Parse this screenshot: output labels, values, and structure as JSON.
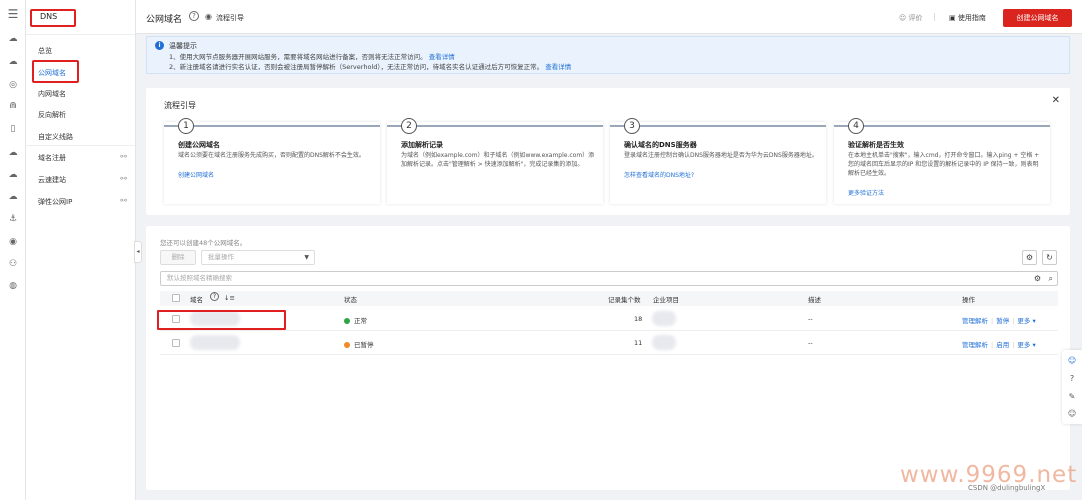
{
  "service": "DNS",
  "sidebar": {
    "items": [
      {
        "label": "总览",
        "active": false,
        "external": false
      },
      {
        "label": "公网域名",
        "active": true,
        "external": false
      },
      {
        "label": "内网域名",
        "active": false,
        "external": false
      },
      {
        "label": "反向解析",
        "active": false,
        "external": false
      },
      {
        "label": "自定义线路",
        "active": false,
        "external": false
      },
      {
        "label": "域名注册",
        "active": false,
        "external": true
      },
      {
        "label": "云速建站",
        "active": false,
        "external": true
      },
      {
        "label": "弹性公网IP",
        "active": false,
        "external": true
      }
    ]
  },
  "header": {
    "title": "公网域名",
    "flow_guide": "流程引导",
    "rate": "评价",
    "guide": "使用指南",
    "create_button": "创建公网域名"
  },
  "notice": {
    "title": "温馨提示",
    "line1": "1、使用大网节点服务器开展网站服务，需要将域名网站进行备案，否则将无法正常访问。",
    "line1_link": "查看详情",
    "line2": "2、新注册域名请进行实名认证，否则会被注册局暂停解析（Serverhold），无法正常访问，待域名实名认证通过后方可恢复正常。",
    "line2_link": "查看详情"
  },
  "flow": {
    "title": "流程引导",
    "steps": [
      {
        "num": "1",
        "title": "创建公网域名",
        "desc": "域名公须要在域名注册服务先成购买，否则配置的DNS解析不会生效。",
        "link": "创建公网域名"
      },
      {
        "num": "2",
        "title": "添加解析记录",
        "desc": "为域名（例如example.com）和子域名（例如www.example.com）添加解析记录。点击\"管理解析 > 快速添加解析\"，完成记录集的添加。",
        "link": ""
      },
      {
        "num": "3",
        "title": "确认域名的DNS服务器",
        "desc": "登录域名注册控制台确认DNS服务器地址是否为华为云DNS服务器地址。",
        "link": "怎样查看域名的DNS地址?"
      },
      {
        "num": "4",
        "title": "验证解析是否生效",
        "desc": "在本地主机单击\"搜索\"，输入cmd，打开命令窗口。输入ping + 空格 + 您的域名回车后显示的IP 和您设置的解析记录中的 IP 保持一致，则表明解析已经生效。",
        "link": "更多验证方法"
      }
    ]
  },
  "list": {
    "quota_text": "您还可以创建48个公网域名。",
    "delete_button": "删除",
    "batch_placeholder": "批量操作",
    "search_placeholder": "默认按照域名精确搜索",
    "columns": [
      "域名",
      "状态",
      "记录集个数",
      "企业项目",
      "描述",
      "操作"
    ],
    "rows": [
      {
        "status": "正常",
        "status_color": "#2aa745",
        "records": "18",
        "description": "--",
        "ops": [
          "管理解析",
          "暂停",
          "更多"
        ]
      },
      {
        "status": "已暂停",
        "status_color": "#f08a24",
        "records": "11",
        "description": "--",
        "ops": [
          "管理解析",
          "启用",
          "更多"
        ]
      }
    ]
  },
  "watermark": "www.9969.net",
  "credit": "CSDN @dulingbulingX",
  "colors": {
    "accent": "#1f6fd6",
    "brand_red": "#d9251d",
    "highlight_red": "#e02020"
  }
}
